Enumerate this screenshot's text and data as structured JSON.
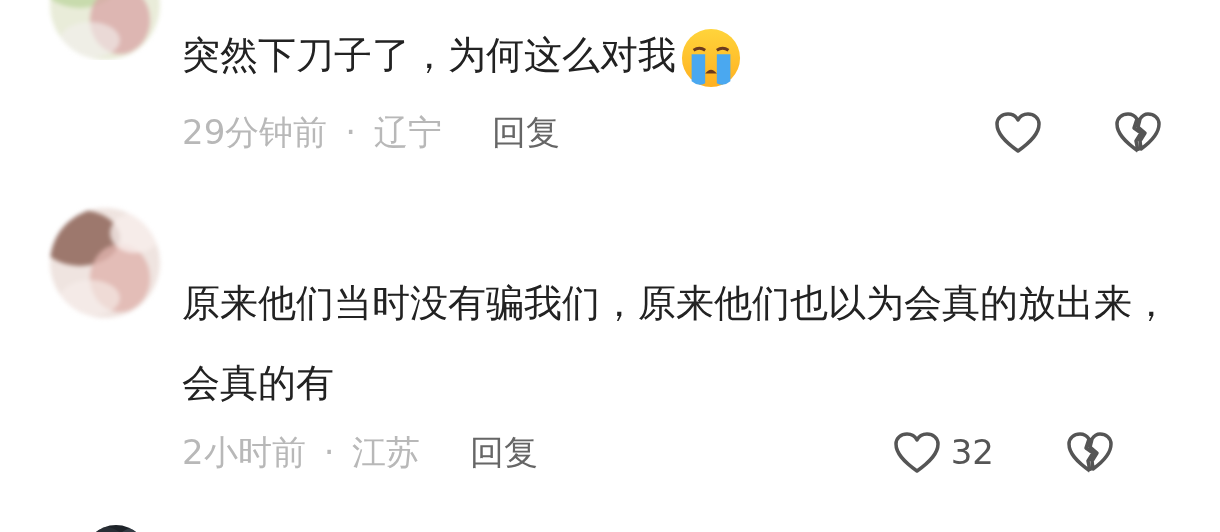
{
  "comments": [
    {
      "text": "突然下刀子了，为何这么对我",
      "trailing_icon": {
        "kind": "crying"
      },
      "time": "29分钟前",
      "separator": "·",
      "location": "辽宁",
      "reply": "回复"
    },
    {
      "text": "原来他们当时没有骗我们，原来他们也以为会真的放出来，会真的有",
      "time": "2小时前",
      "separator": "·",
      "location": "江苏",
      "reply": "回复",
      "likes": "32"
    }
  ]
}
